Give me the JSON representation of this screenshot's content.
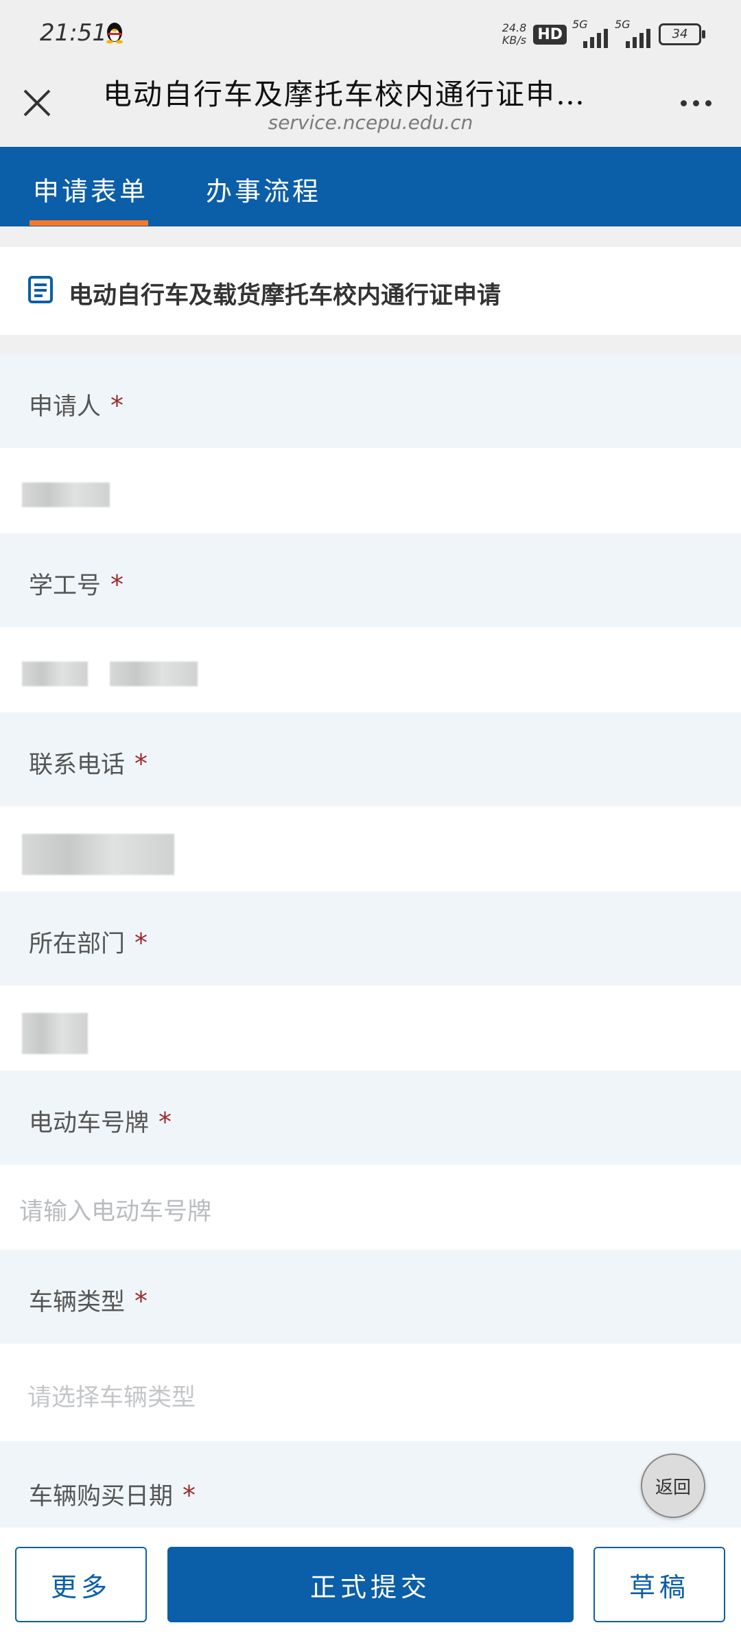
{
  "status": {
    "time": "21:51",
    "speed_value": "24.8",
    "speed_unit": "KB/s",
    "hd": "HD",
    "net1": "5G",
    "net2": "5G",
    "battery": "34"
  },
  "titlebar": {
    "title": "电动自行车及摩托车校内通行证申…",
    "subtitle": "service.ncepu.edu.cn"
  },
  "tabs": [
    {
      "label": "申请表单"
    },
    {
      "label": "办事流程"
    }
  ],
  "section": {
    "title": "电动自行车及载货摩托车校内通行证申请"
  },
  "fields": [
    {
      "label": "申请人",
      "required": "*"
    },
    {
      "label": "学工号",
      "required": "*"
    },
    {
      "label": "联系电话",
      "required": "*"
    },
    {
      "label": "所在部门",
      "required": "*"
    },
    {
      "label": "电动车号牌",
      "required": "*",
      "placeholder": "请输入电动车号牌"
    },
    {
      "label": "车辆类型",
      "required": "*",
      "placeholder": "请选择车辆类型"
    },
    {
      "label": "车辆购买日期",
      "required": "*"
    }
  ],
  "floating": {
    "return_label": "返回"
  },
  "bottom": {
    "more_label": "更多",
    "submit_label": "正式提交",
    "draft_label": "草稿"
  },
  "colors": {
    "primary": "#0b5ea8",
    "tab_indicator": "#f47a2a",
    "required": "#9b2b2b"
  }
}
